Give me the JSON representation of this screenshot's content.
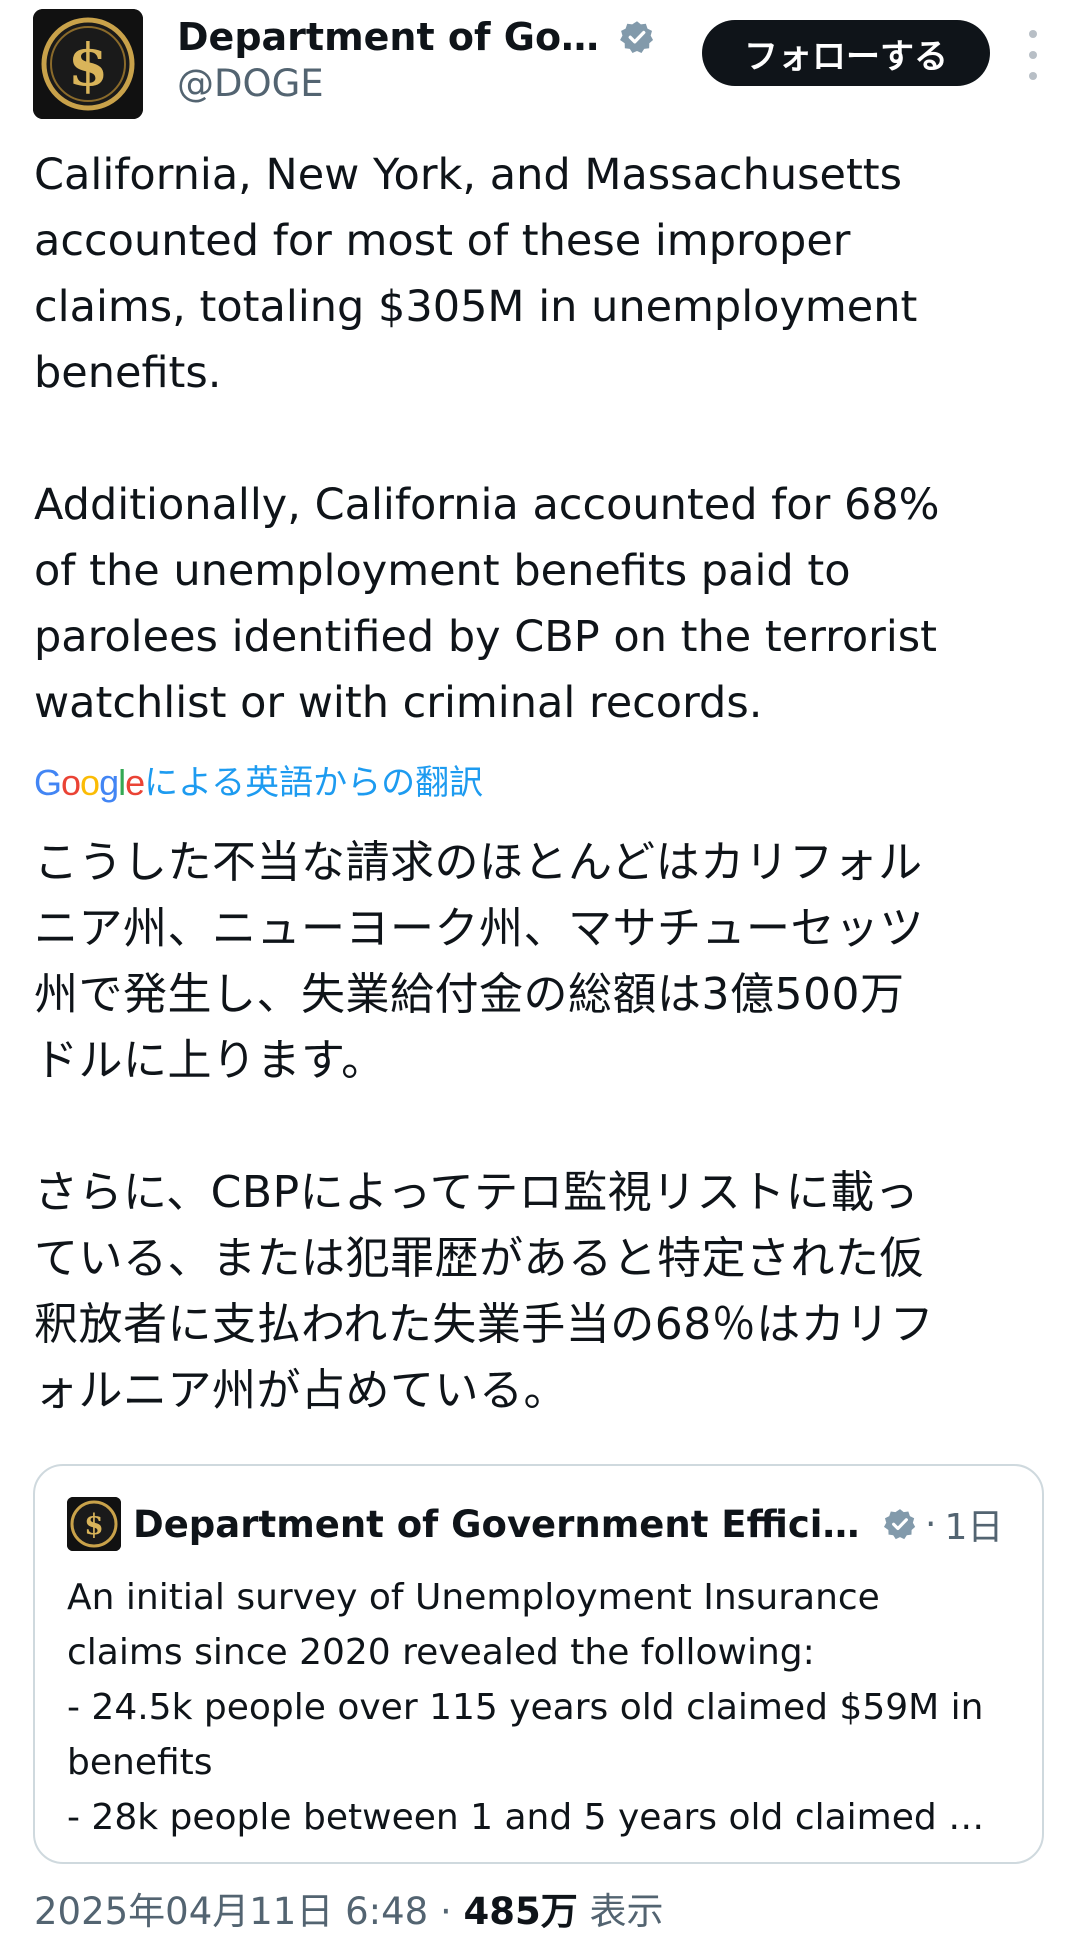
{
  "author": {
    "display_name": "Department of Gove…",
    "handle": "@DOGE",
    "verified": true,
    "avatar_symbol": "$"
  },
  "follow_button_label": "フォローする",
  "tweet_text": {
    "paragraph1": [
      "California, New York, and Massachusetts",
      "accounted for most of these improper",
      "claims, totaling $305M in unemployment",
      "benefits."
    ],
    "paragraph2": [
      "Additionally, California accounted for 68%",
      "of the unemployment benefits paid to",
      "parolees identified by CBP on the terrorist",
      "watchlist or with criminal records."
    ]
  },
  "translation": {
    "google_logo": "Google",
    "label": "による英語からの翻訳"
  },
  "translated_text": {
    "paragraph1": [
      "こうした不当な請求のほとんどはカリフォル",
      "ニア州、ニューヨーク州、マサチューセッツ",
      "州で発生し、失業給付金の総額は3億500万",
      "ドルに上ります。"
    ],
    "paragraph2": [
      "さらに、CBPによってテロ監視リストに載っ",
      "ている、または犯罪歴があると特定された仮",
      "釈放者に支払われた失業手当の68％はカリフ",
      "ォルニア州が占めている。"
    ]
  },
  "quoted_tweet": {
    "display_name": "Department of Government Efficien…",
    "separator": "·",
    "time": "1日",
    "lines": [
      "An initial survey of Unemployment Insurance",
      "claims since 2020 revealed the following:",
      "- 24.5k people over 115 years old claimed $59M in",
      "benefits",
      "- 28k people between 1 and 5 years old claimed …"
    ]
  },
  "meta": {
    "timestamp": "2025年04月11日 6:48",
    "separator": "·",
    "views_count": "485万",
    "views_label": "表示"
  },
  "colors": {
    "text_primary": "#0f1419",
    "text_secondary": "#536471",
    "link_blue": "#1d9bf0",
    "verified_blue": "#829aab",
    "border": "#cfd9de",
    "avatar_gold": "#c9a24a"
  },
  "icons": {
    "verified": "verified-badge-icon",
    "more": "more-options-icon",
    "avatar": "dollar-coin-logo"
  }
}
